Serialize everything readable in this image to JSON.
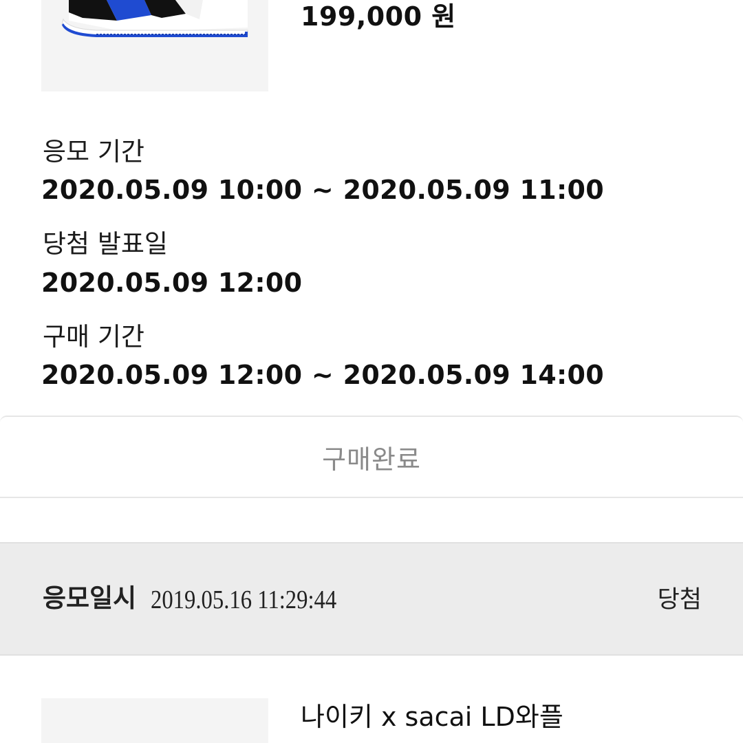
{
  "product": {
    "image_alt": "sneaker image",
    "price": "199,000 원"
  },
  "schedule": [
    {
      "label": "응모 기간",
      "value": "2020.05.09 10:00 ~ 2020.05.09 11:00"
    },
    {
      "label": "당첨 발표일",
      "value": "2020.05.09 12:00"
    },
    {
      "label": "구매 기간",
      "value": "2020.05.09 12:00 ~ 2020.05.09 14:00"
    }
  ],
  "purchase_button": {
    "label": "구매완료"
  },
  "entry": {
    "label": "응모일시",
    "datetime": "2019.05.16 11:29:44",
    "status": "당첨"
  },
  "next_product": {
    "name": "나이키 x sacai LD와플"
  },
  "colors": {
    "thumb_bg": "#f4f4f4",
    "shoe_blue": "#1f4bd1",
    "shoe_black": "#111111",
    "muted_text": "#8a8a8a",
    "header_bg": "#ececec"
  }
}
